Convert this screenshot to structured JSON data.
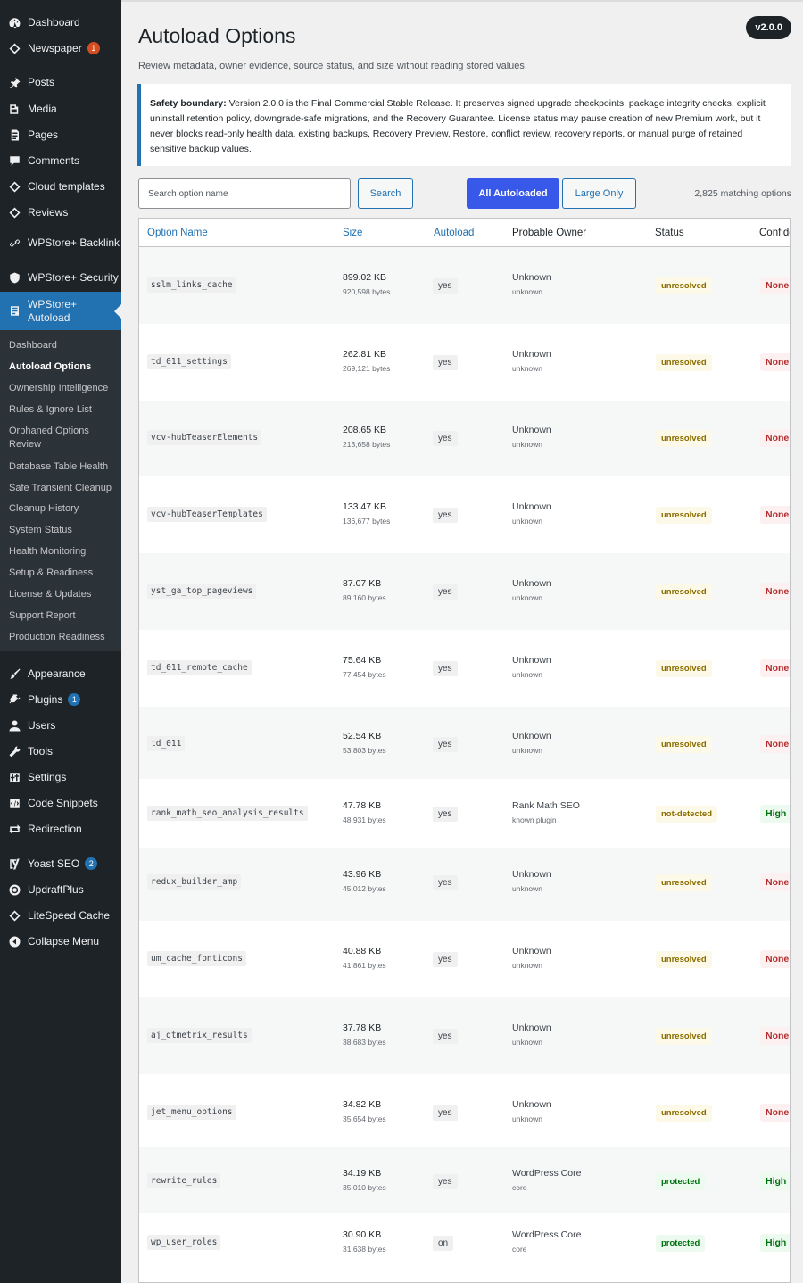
{
  "sidebar": {
    "top_items": [
      {
        "label": "Dashboard",
        "icon": "dashboard-icon"
      },
      {
        "label": "Newspaper",
        "icon": "newspaper-icon",
        "badge": "1"
      },
      {
        "label": "Posts",
        "icon": "pin-icon"
      },
      {
        "label": "Media",
        "icon": "media-icon"
      },
      {
        "label": "Pages",
        "icon": "page-icon"
      },
      {
        "label": "Comments",
        "icon": "comment-icon"
      },
      {
        "label": "Cloud templates",
        "icon": "diamond-icon"
      },
      {
        "label": "Reviews",
        "icon": "diamond-icon"
      },
      {
        "label": "WPStore+ Backlink",
        "icon": "link-icon"
      },
      {
        "label": "WPStore+ Security",
        "icon": "shield-icon"
      },
      {
        "label": "WPStore+ Autoload",
        "icon": "database-icon"
      }
    ],
    "submenu": [
      {
        "label": "Dashboard"
      },
      {
        "label": "Autoload Options"
      },
      {
        "label": "Ownership Intelligence"
      },
      {
        "label": "Rules & Ignore List"
      },
      {
        "label": "Orphaned Options Review"
      },
      {
        "label": "Database Table Health"
      },
      {
        "label": "Safe Transient Cleanup"
      },
      {
        "label": "Cleanup History"
      },
      {
        "label": "System Status"
      },
      {
        "label": "Health Monitoring"
      },
      {
        "label": "Setup & Readiness"
      },
      {
        "label": "License & Updates"
      },
      {
        "label": "Support Report"
      },
      {
        "label": "Production Readiness"
      }
    ],
    "bottom_items": [
      {
        "label": "Appearance",
        "icon": "brush-icon"
      },
      {
        "label": "Plugins",
        "icon": "plug-icon",
        "badge": "1"
      },
      {
        "label": "Users",
        "icon": "user-icon"
      },
      {
        "label": "Tools",
        "icon": "wrench-icon"
      },
      {
        "label": "Settings",
        "icon": "settings-icon"
      },
      {
        "label": "Code Snippets",
        "icon": "code-icon"
      },
      {
        "label": "Redirection",
        "icon": "redirect-icon"
      },
      {
        "label": "Yoast SEO",
        "icon": "yoast-icon",
        "badge": "2"
      },
      {
        "label": "UpdraftPlus",
        "icon": "updraft-icon"
      },
      {
        "label": "LiteSpeed Cache",
        "icon": "diamond-icon"
      },
      {
        "label": "Collapse Menu",
        "icon": "collapse-icon"
      }
    ]
  },
  "header": {
    "title": "Autoload Options",
    "version": "v2.0.0",
    "subtitle": "Review metadata, owner evidence, source status, and size without reading stored values."
  },
  "notice": {
    "label": "Safety boundary:",
    "text": " Version 2.0.0 is the Final Commercial Stable Release. It preserves signed upgrade checkpoints, package integrity checks, explicit uninstall retention policy, downgrade-safe migrations, and the Recovery Guarantee. License status may pause creation of new Premium work, but it never blocks read-only health data, existing backups, Recovery Preview, Restore, conflict review, recovery reports, or manual purge of retained sensitive backup values."
  },
  "toolbar": {
    "search_placeholder": "Search option name",
    "search_label": "Search",
    "all_label": "All Autoloaded",
    "large_label": "Large Only",
    "match_count": "2,825 matching options"
  },
  "table": {
    "headers": {
      "option_name": "Option Name",
      "size": "Size",
      "autoload": "Autoload",
      "owner": "Probable Owner",
      "status": "Status",
      "confidence": "Confidence"
    },
    "rows": [
      {
        "name": "sslm_links_cache",
        "size": "899.02 KB",
        "bytes": "920,598 bytes",
        "autoload": "yes",
        "owner": "Unknown",
        "owner_sub": "unknown",
        "status": "unresolved",
        "confidence": "None"
      },
      {
        "name": "td_011_settings",
        "size": "262.81 KB",
        "bytes": "269,121 bytes",
        "autoload": "yes",
        "owner": "Unknown",
        "owner_sub": "unknown",
        "status": "unresolved",
        "confidence": "None"
      },
      {
        "name": "vcv-hubTeaserElements",
        "size": "208.65 KB",
        "bytes": "213,658 bytes",
        "autoload": "yes",
        "owner": "Unknown",
        "owner_sub": "unknown",
        "status": "unresolved",
        "confidence": "None"
      },
      {
        "name": "vcv-hubTeaserTemplates",
        "size": "133.47 KB",
        "bytes": "136,677 bytes",
        "autoload": "yes",
        "owner": "Unknown",
        "owner_sub": "unknown",
        "status": "unresolved",
        "confidence": "None"
      },
      {
        "name": "yst_ga_top_pageviews",
        "size": "87.07 KB",
        "bytes": "89,160 bytes",
        "autoload": "yes",
        "owner": "Unknown",
        "owner_sub": "unknown",
        "status": "unresolved",
        "confidence": "None"
      },
      {
        "name": "td_011_remote_cache",
        "size": "75.64 KB",
        "bytes": "77,454 bytes",
        "autoload": "yes",
        "owner": "Unknown",
        "owner_sub": "unknown",
        "status": "unresolved",
        "confidence": "None"
      },
      {
        "name": "td_011",
        "size": "52.54 KB",
        "bytes": "53,803 bytes",
        "autoload": "yes",
        "owner": "Unknown",
        "owner_sub": "unknown",
        "status": "unresolved",
        "confidence": "None"
      },
      {
        "name": "rank_math_seo_analysis_results",
        "size": "47.78 KB",
        "bytes": "48,931 bytes",
        "autoload": "yes",
        "owner": "Rank Math SEO",
        "owner_sub": "known plugin",
        "status": "not-detected",
        "confidence": "High"
      },
      {
        "name": "redux_builder_amp",
        "size": "43.96 KB",
        "bytes": "45,012 bytes",
        "autoload": "yes",
        "owner": "Unknown",
        "owner_sub": "unknown",
        "status": "unresolved",
        "confidence": "None"
      },
      {
        "name": "um_cache_fonticons",
        "size": "40.88 KB",
        "bytes": "41,861 bytes",
        "autoload": "yes",
        "owner": "Unknown",
        "owner_sub": "unknown",
        "status": "unresolved",
        "confidence": "None"
      },
      {
        "name": "aj_gtmetrix_results",
        "size": "37.78 KB",
        "bytes": "38,683 bytes",
        "autoload": "yes",
        "owner": "Unknown",
        "owner_sub": "unknown",
        "status": "unresolved",
        "confidence": "None"
      },
      {
        "name": "jet_menu_options",
        "size": "34.82 KB",
        "bytes": "35,654 bytes",
        "autoload": "yes",
        "owner": "Unknown",
        "owner_sub": "unknown",
        "status": "unresolved",
        "confidence": "None"
      },
      {
        "name": "rewrite_rules",
        "size": "34.19 KB",
        "bytes": "35,010 bytes",
        "autoload": "yes",
        "owner": "WordPress Core",
        "owner_sub": "core",
        "status": "protected",
        "confidence": "High"
      },
      {
        "name": "wp_user_roles",
        "size": "30.90 KB",
        "bytes": "31,638 bytes",
        "autoload": "on",
        "owner": "WordPress Core",
        "owner_sub": "core",
        "status": "protected",
        "confidence": "High"
      }
    ]
  }
}
